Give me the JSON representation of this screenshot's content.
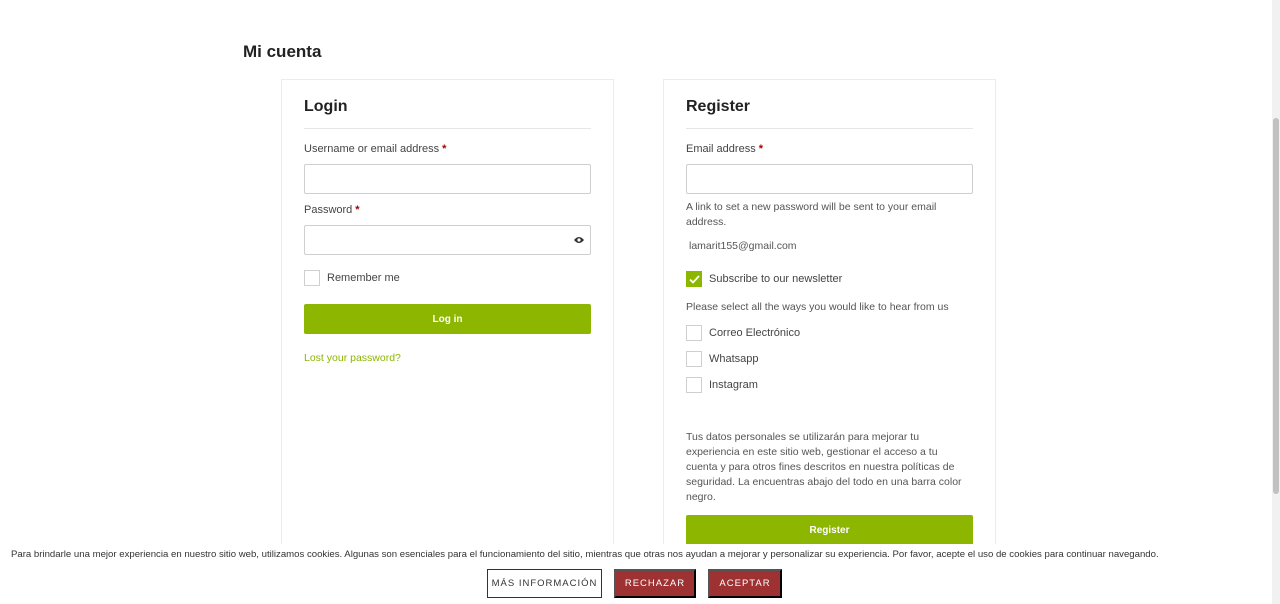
{
  "page": {
    "title": "Mi cuenta"
  },
  "login": {
    "title": "Login",
    "username_label": "Username or email address",
    "required_mark": "*",
    "username_value": "",
    "password_label": "Password",
    "password_value": "",
    "remember_label": "Remember me",
    "login_button": "Log in",
    "lost_password": "Lost your password?"
  },
  "register": {
    "title": "Register",
    "email_label": "Email address",
    "email_value": "",
    "password_note": "A link to set a new password will be sent to your email address.",
    "email_display": "lamarit155@gmail.com",
    "newsletter_label": "Subscribe to our newsletter",
    "ways_prompt": "Please select all the ways you would like to hear from us",
    "options": [
      "Correo Electrónico",
      "Whatsapp",
      "Instagram"
    ],
    "privacy_text": "Tus datos personales se utilizarán para mejorar tu experiencia en este sitio web, gestionar el acceso a tu cuenta y para otros fines descritos en nuestra políticas de seguridad. La encuentras abajo del todo en una barra color negro.",
    "register_button": "Register"
  },
  "cookies": {
    "text": "Para brindarle una mejor experiencia en nuestro sitio web, utilizamos cookies. Algunas son esenciales para el funcionamiento del sitio, mientras que otras nos ayudan a mejorar y personalizar su experiencia. Por favor, acepte el uso de cookies para continuar navegando.",
    "more_info": "MÁS INFORMACIÓN",
    "reject": "RECHAZAR",
    "accept": "ACEPTAR"
  },
  "colors": {
    "accent": "#8db600",
    "cookie_button": "#9e3132",
    "required": "#a30000"
  },
  "icons": {
    "password_toggle": "eye-icon",
    "check": "checkmark-icon"
  }
}
